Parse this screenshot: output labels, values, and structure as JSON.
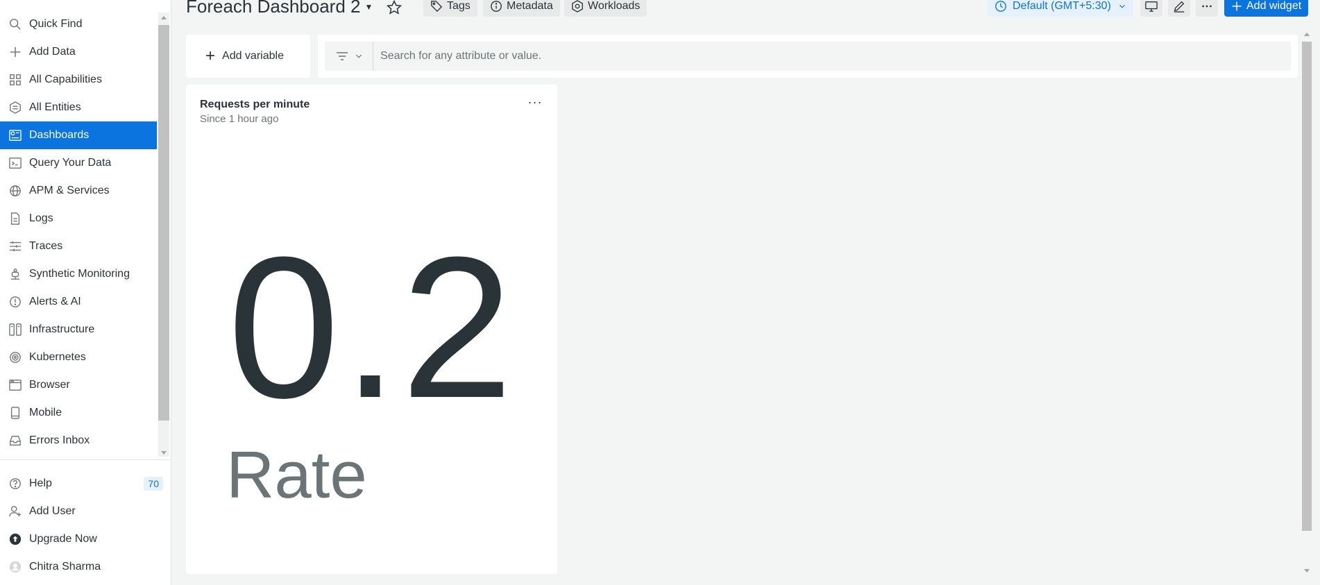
{
  "sidebar": {
    "items": [
      {
        "label": "Quick Find",
        "icon": "search-icon"
      },
      {
        "label": "Add Data",
        "icon": "plus-icon"
      },
      {
        "label": "All Capabilities",
        "icon": "grid-icon"
      },
      {
        "label": "All Entities",
        "icon": "entities-icon"
      },
      {
        "label": "Dashboards",
        "icon": "dashboard-icon"
      },
      {
        "label": "Query Your Data",
        "icon": "terminal-icon"
      },
      {
        "label": "APM & Services",
        "icon": "globe-icon"
      },
      {
        "label": "Logs",
        "icon": "document-icon"
      },
      {
        "label": "Traces",
        "icon": "traces-icon"
      },
      {
        "label": "Synthetic Monitoring",
        "icon": "robot-icon"
      },
      {
        "label": "Alerts & AI",
        "icon": "alert-icon"
      },
      {
        "label": "Infrastructure",
        "icon": "server-icon"
      },
      {
        "label": "Kubernetes",
        "icon": "kubernetes-icon"
      },
      {
        "label": "Browser",
        "icon": "browser-icon"
      },
      {
        "label": "Mobile",
        "icon": "mobile-icon"
      },
      {
        "label": "Errors Inbox",
        "icon": "inbox-icon"
      }
    ],
    "active": "Dashboards",
    "bottom": {
      "help": "Help",
      "help_badge": "70",
      "add_user": "Add User",
      "upgrade": "Upgrade Now",
      "user": "Chitra Sharma"
    }
  },
  "header": {
    "title": "Foreach Dashboard 2",
    "tags": "Tags",
    "metadata": "Metadata",
    "workloads": "Workloads",
    "timezone": "Default (GMT+5:30)",
    "add_widget": "Add widget"
  },
  "toolbar": {
    "add_variable": "Add variable",
    "search_placeholder": "Search for any attribute or value."
  },
  "widget": {
    "title": "Requests per minute",
    "subtitle": "Since 1 hour ago",
    "value": "0.2",
    "unit": "Rate",
    "menu": "···"
  },
  "colors": {
    "accent": "#0c74df",
    "text": "#293338",
    "muted": "#6b7477",
    "background": "#f3f4f4"
  }
}
